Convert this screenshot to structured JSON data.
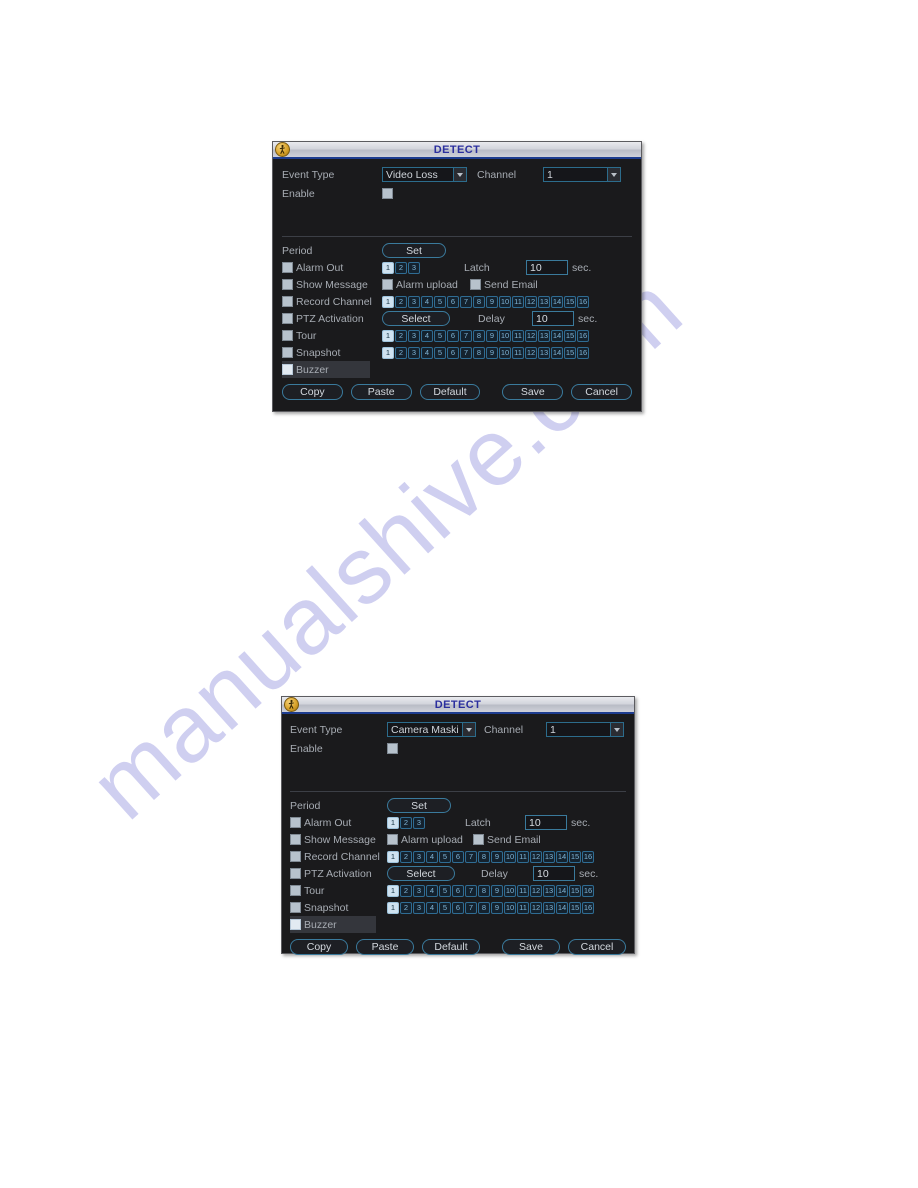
{
  "page": {
    "background": "#ffffff",
    "watermark_text": "manualshive.com",
    "watermark_color": "#cfcff0"
  },
  "theme": {
    "dialog_bg": "#1a1a1c",
    "title_text_color": "#2b2f9e",
    "label_color": "#a7acb3",
    "accent_border": "#3a7a9c",
    "channel_box_border": "#2f6c93",
    "channel_box_selected_bg": "#cfe2f0",
    "highlight_row_bg": "#34363c"
  },
  "dialogs": [
    {
      "id": "video-loss",
      "titlebar": {
        "icon": "walking-person-badge-icon",
        "title": "DETECT"
      },
      "form": {
        "event_type_label": "Event Type",
        "event_type_value": "Video Loss",
        "channel_label": "Channel",
        "channel_value": "1",
        "enable_label": "Enable",
        "enable_checked": false
      },
      "period": {
        "label": "Period",
        "set_button": "Set"
      },
      "options": {
        "alarm_out_label": "Alarm Out",
        "alarm_out_boxes": [
          "1",
          "2",
          "3"
        ],
        "alarm_out_selected": [
          "1"
        ],
        "latch_label": "Latch",
        "latch_value": "10",
        "latch_unit": "sec.",
        "show_message_label": "Show Message",
        "alarm_upload_label": "Alarm upload",
        "send_email_label": "Send Email",
        "record_channel_label": "Record Channel",
        "ptz_activation_label": "PTZ Activation",
        "select_button": "Select",
        "delay_label": "Delay",
        "delay_value": "10",
        "delay_unit": "sec.",
        "tour_label": "Tour",
        "snapshot_label": "Snapshot",
        "buzzer_label": "Buzzer",
        "buzzer_highlighted": true,
        "channel_boxes": [
          "1",
          "2",
          "3",
          "4",
          "5",
          "6",
          "7",
          "8",
          "9",
          "10",
          "11",
          "12",
          "13",
          "14",
          "15",
          "16"
        ],
        "channel_selected": [
          "1"
        ]
      },
      "buttons": {
        "copy": "Copy",
        "paste": "Paste",
        "default": "Default",
        "save": "Save",
        "cancel": "Cancel"
      }
    },
    {
      "id": "camera-masking",
      "titlebar": {
        "icon": "walking-person-badge-icon",
        "title": "DETECT"
      },
      "form": {
        "event_type_label": "Event Type",
        "event_type_value": "Camera Maski",
        "channel_label": "Channel",
        "channel_value": "1",
        "enable_label": "Enable",
        "enable_checked": false
      },
      "period": {
        "label": "Period",
        "set_button": "Set"
      },
      "options": {
        "alarm_out_label": "Alarm Out",
        "alarm_out_boxes": [
          "1",
          "2",
          "3"
        ],
        "alarm_out_selected": [
          "1"
        ],
        "latch_label": "Latch",
        "latch_value": "10",
        "latch_unit": "sec.",
        "show_message_label": "Show Message",
        "alarm_upload_label": "Alarm upload",
        "send_email_label": "Send Email",
        "record_channel_label": "Record Channel",
        "ptz_activation_label": "PTZ Activation",
        "select_button": "Select",
        "delay_label": "Delay",
        "delay_value": "10",
        "delay_unit": "sec.",
        "tour_label": "Tour",
        "snapshot_label": "Snapshot",
        "buzzer_label": "Buzzer",
        "buzzer_highlighted": true,
        "channel_boxes": [
          "1",
          "2",
          "3",
          "4",
          "5",
          "6",
          "7",
          "8",
          "9",
          "10",
          "11",
          "12",
          "13",
          "14",
          "15",
          "16"
        ],
        "channel_selected": [
          "1"
        ]
      },
      "buttons": {
        "copy": "Copy",
        "paste": "Paste",
        "default": "Default",
        "save": "Save",
        "cancel": "Cancel"
      }
    }
  ]
}
